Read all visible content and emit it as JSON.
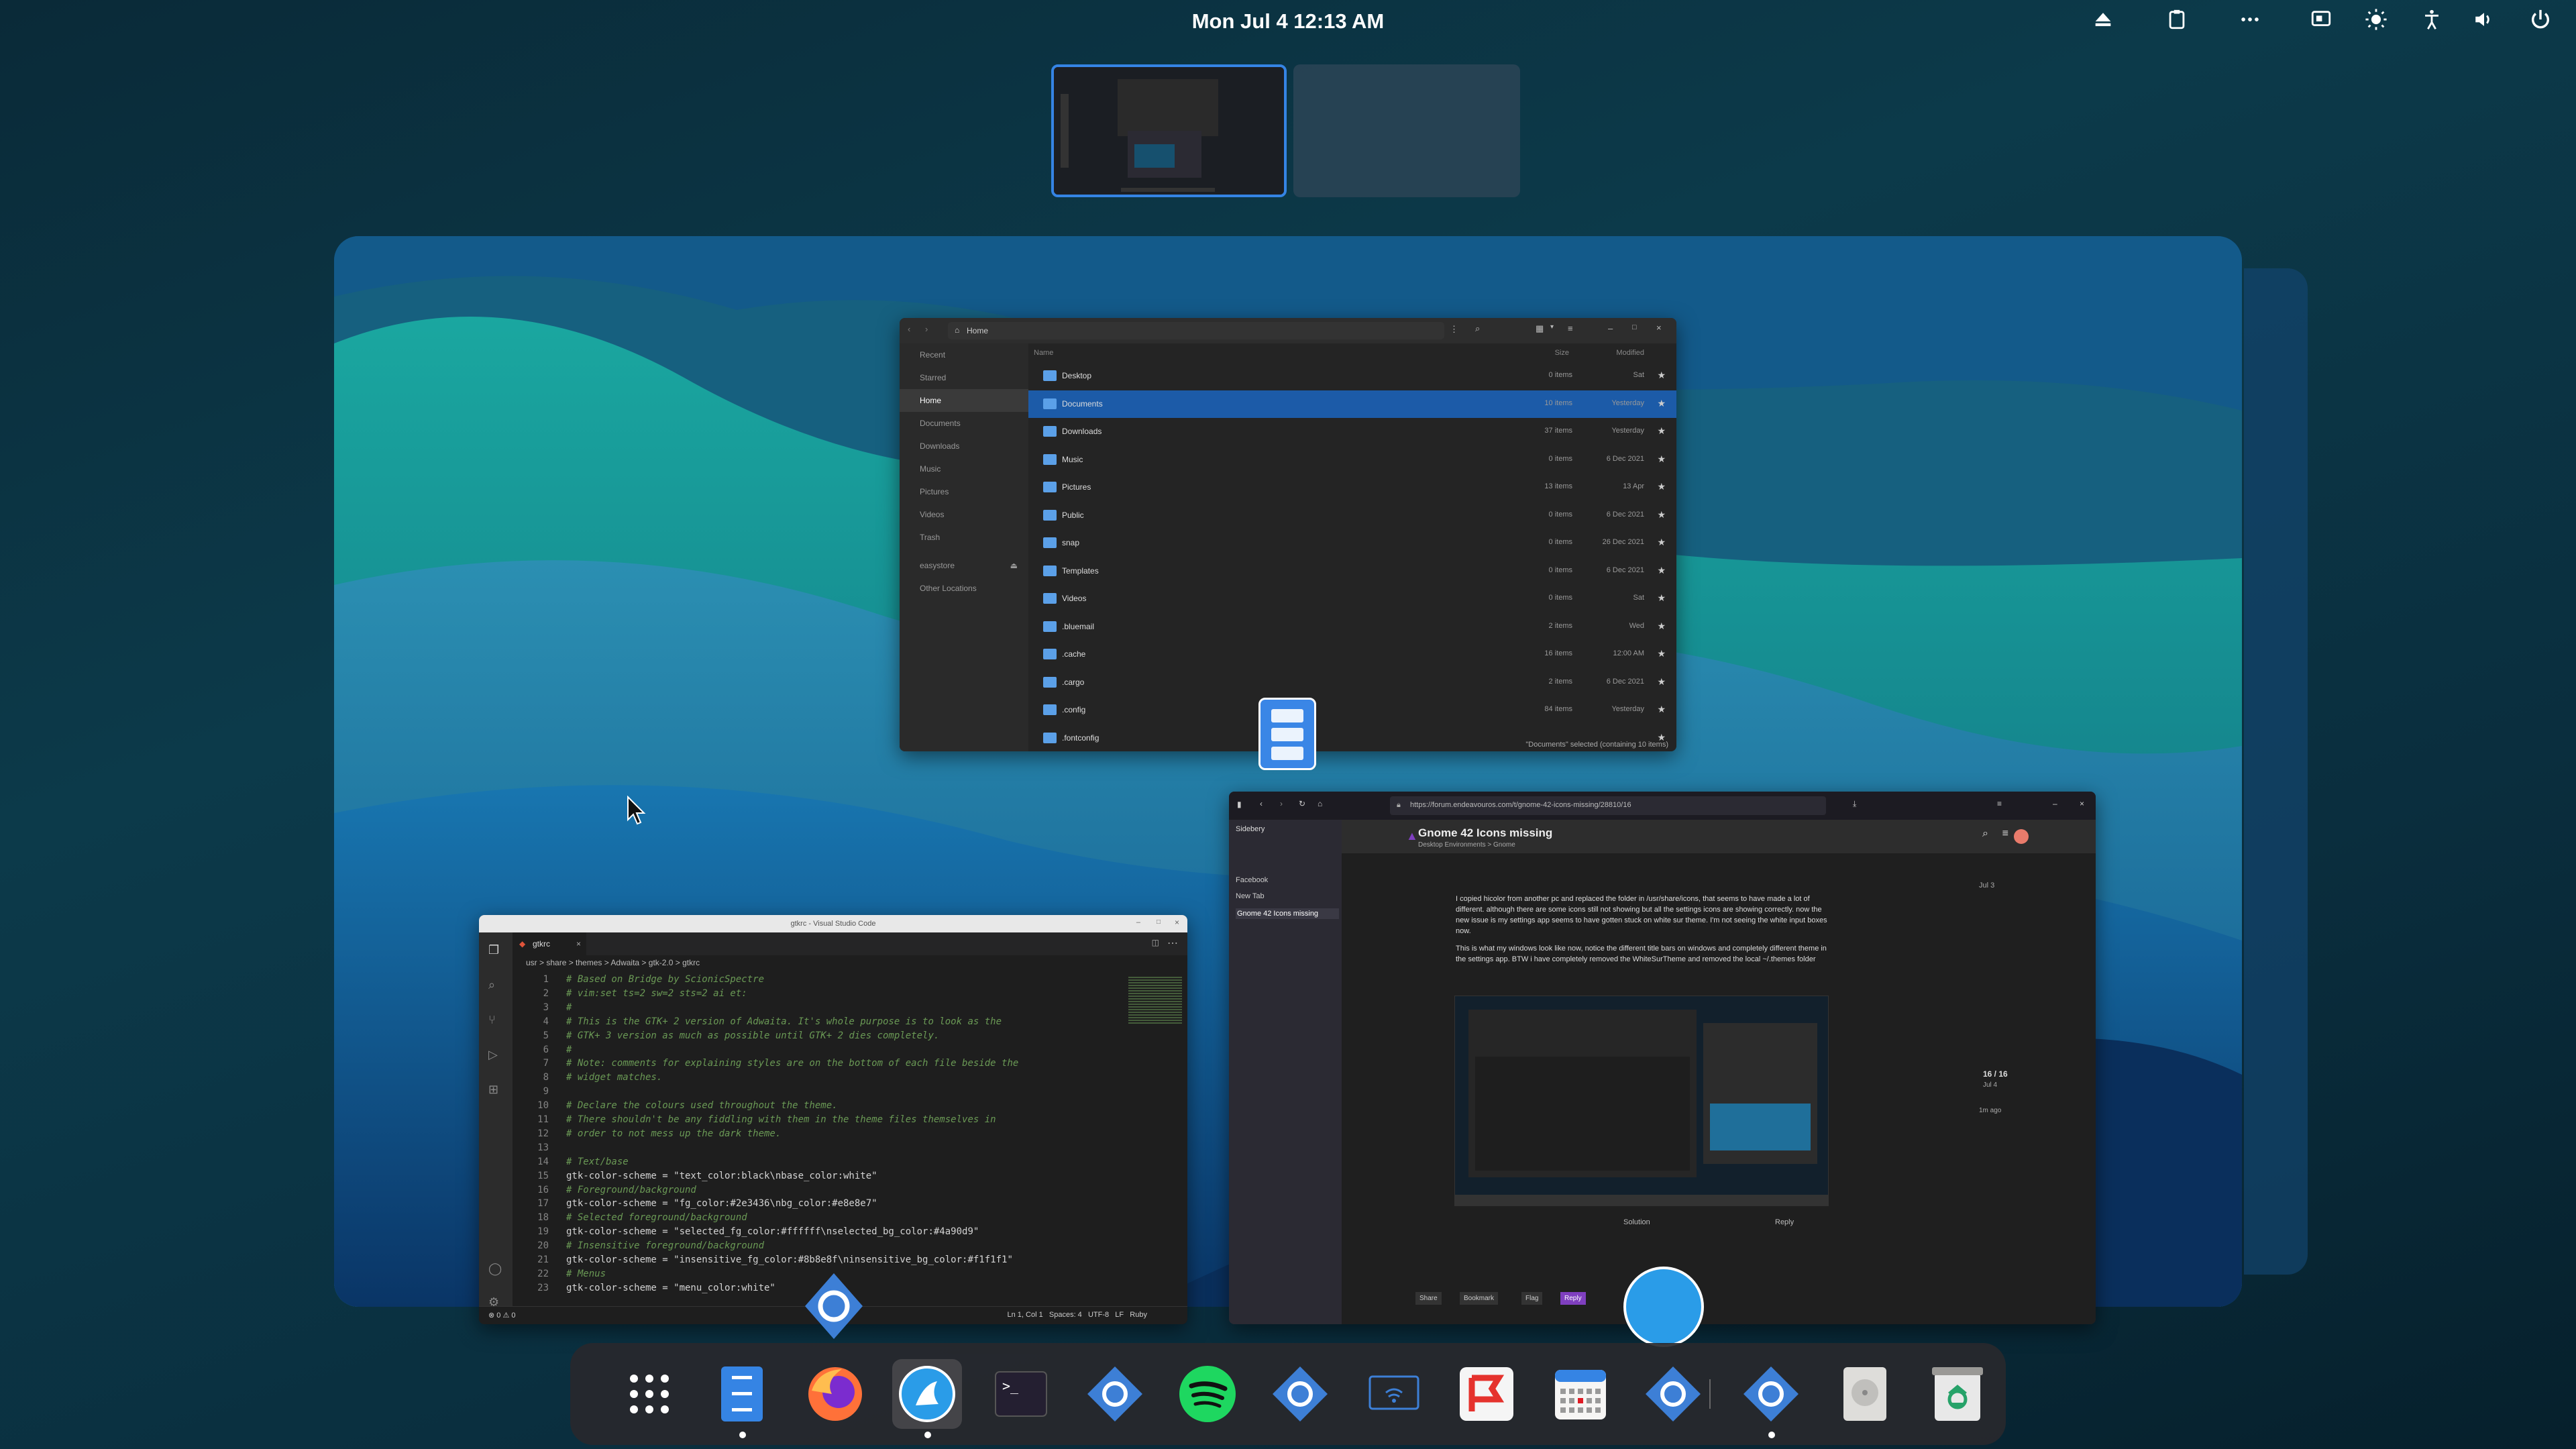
{
  "topbar": {
    "clock": "Mon Jul 4  12:13 AM",
    "tray_icons": [
      "eject-icon",
      "clipboard-icon",
      "more-icon",
      "screen-share-icon",
      "brightness-icon",
      "accessibility-icon",
      "volume-icon",
      "power-icon"
    ]
  },
  "files": {
    "location": "Home",
    "sidebar": [
      "Recent",
      "Starred",
      "Home",
      "Documents",
      "Downloads",
      "Music",
      "Pictures",
      "Videos",
      "Trash",
      "easystore",
      "Other Locations"
    ],
    "columns": {
      "name": "Name",
      "size": "Size",
      "modified": "Modified"
    },
    "rows": [
      {
        "name": "Desktop",
        "size": "0 items",
        "modified": "Sat"
      },
      {
        "name": "Documents",
        "size": "10 items",
        "modified": "Yesterday"
      },
      {
        "name": "Downloads",
        "size": "37 items",
        "modified": "Yesterday"
      },
      {
        "name": "Music",
        "size": "0 items",
        "modified": "6 Dec 2021"
      },
      {
        "name": "Pictures",
        "size": "13 items",
        "modified": "13 Apr"
      },
      {
        "name": "Public",
        "size": "0 items",
        "modified": "6 Dec 2021"
      },
      {
        "name": "snap",
        "size": "0 items",
        "modified": "26 Dec 2021"
      },
      {
        "name": "Templates",
        "size": "0 items",
        "modified": "6 Dec 2021"
      },
      {
        "name": "Videos",
        "size": "0 items",
        "modified": "Sat"
      },
      {
        "name": ".bluemail",
        "size": "2 items",
        "modified": "Wed"
      },
      {
        "name": ".cache",
        "size": "16 items",
        "modified": "12:00 AM"
      },
      {
        "name": ".cargo",
        "size": "2 items",
        "modified": "6 Dec 2021"
      },
      {
        "name": ".config",
        "size": "84 items",
        "modified": "Yesterday"
      },
      {
        "name": ".fontconfig",
        "size": "",
        "modified": ""
      }
    ],
    "status": "\"Documents\" selected (containing 10 items)"
  },
  "vscode": {
    "title": "gtkrc - Visual Studio Code",
    "tab": "gtkrc",
    "breadcrumb": "usr > share > themes > Adwaita > gtk-2.0 > gtkrc",
    "lines": [
      {
        "n": "1",
        "t": "# Based on Bridge by ScionicSpectre",
        "c": "cm"
      },
      {
        "n": "2",
        "t": "# vim:set ts=2 sw=2 sts=2 ai et:",
        "c": "cm"
      },
      {
        "n": "3",
        "t": "#",
        "c": "cm"
      },
      {
        "n": "4",
        "t": "# This is the GTK+ 2 version of Adwaita. It's whole purpose is to look as the",
        "c": "cm"
      },
      {
        "n": "5",
        "t": "# GTK+ 3 version as much as possible until GTK+ 2 dies completely.",
        "c": "cm"
      },
      {
        "n": "6",
        "t": "#",
        "c": "cm"
      },
      {
        "n": "7",
        "t": "# Note: comments for explaining styles are on the bottom of each file beside the",
        "c": "cm"
      },
      {
        "n": "8",
        "t": "# widget matches.",
        "c": "cm"
      },
      {
        "n": "9",
        "t": "",
        "c": "cv"
      },
      {
        "n": "10",
        "t": "# Declare the colours used throughout the theme.",
        "c": "cm"
      },
      {
        "n": "11",
        "t": "# There shouldn't be any fiddling with them in the theme files themselves in",
        "c": "cm"
      },
      {
        "n": "12",
        "t": "# order to not mess up the dark theme.",
        "c": "cm"
      },
      {
        "n": "13",
        "t": "",
        "c": "cv"
      },
      {
        "n": "14",
        "t": "# Text/base",
        "c": "cm"
      },
      {
        "n": "15",
        "t": "gtk-color-scheme = \"text_color:black\\nbase_color:white\"",
        "c": "cv"
      },
      {
        "n": "16",
        "t": "# Foreground/background",
        "c": "cm"
      },
      {
        "n": "17",
        "t": "gtk-color-scheme = \"fg_color:#2e3436\\nbg_color:#e8e8e7\"",
        "c": "cv"
      },
      {
        "n": "18",
        "t": "# Selected foreground/background",
        "c": "cm"
      },
      {
        "n": "19",
        "t": "gtk-color-scheme = \"selected_fg_color:#ffffff\\nselected_bg_color:#4a90d9\"",
        "c": "cv"
      },
      {
        "n": "20",
        "t": "# Insensitive foreground/background",
        "c": "cm"
      },
      {
        "n": "21",
        "t": "gtk-color-scheme = \"insensitive_fg_color:#8b8e8f\\ninsensitive_bg_color:#f1f1f1\"",
        "c": "cv"
      },
      {
        "n": "22",
        "t": "# Menus",
        "c": "cm"
      },
      {
        "n": "23",
        "t": "gtk-color-scheme = \"menu_color:white\"",
        "c": "cv"
      }
    ],
    "status_left": "⊗ 0 ⚠ 0",
    "status_right": "Ln 1, Col 1   Spaces: 4   UTF-8   LF   Ruby"
  },
  "browser": {
    "url": "https://forum.endeavouros.com/t/gnome-42-icons-missing/28810/16",
    "sidebar_title": "Sidebery",
    "tabs": [
      "Facebook",
      "New Tab",
      "Gnome 42 Icons missing"
    ],
    "topic": "Gnome 42 Icons missing",
    "category": "Desktop Environments > Gnome",
    "post_p1": "I copied hicolor from another pc and replaced the folder in /usr/share/icons, that seems to have made a lot of different. although there are some icons still not showing but all the settings icons are showing correctly. now the new issue is my settings app seems to have gotten stuck on white sur theme. I'm not seeing the white input boxes now.",
    "post_p2": "This is what my windows look like now, notice the different title bars on windows and completely different theme in the settings app. BTW i have completely removed the WhiteSurTheme and removed the local ~/.themes folder",
    "date": "Jul 3",
    "progress": "16 / 16",
    "progress_date": "Jul 4",
    "ago": "1m ago",
    "actions": [
      "Solution",
      "Reply"
    ],
    "bottom_actions": [
      "Share",
      "Bookmark",
      "Flag",
      "Reply"
    ]
  },
  "dock": {
    "apps": [
      "app-grid-icon",
      "files-icon",
      "firefox-icon",
      "endeavouros-icon",
      "terminal-icon",
      "settings-gear-icon",
      "spotify-icon",
      "settings-gear-icon",
      "network-icon",
      "flathub-icon",
      "calendar-icon",
      "settings-gear-icon",
      "settings-gear-icon",
      "disk-icon",
      "trash-icon"
    ]
  }
}
